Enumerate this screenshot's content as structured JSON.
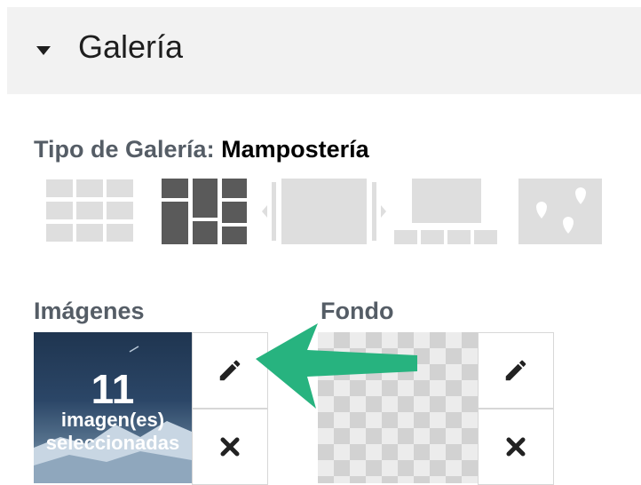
{
  "section": {
    "title": "Galería",
    "icon": "caret-down-icon"
  },
  "gallery_type": {
    "label": "Tipo de Galería:",
    "selected": "Mampostería",
    "options": [
      {
        "icon": "grid-layout-icon",
        "selected": false
      },
      {
        "icon": "masonry-layout-icon",
        "selected": true
      },
      {
        "icon": "slider-layout-icon",
        "selected": false
      },
      {
        "icon": "thumbnail-slider-layout-icon",
        "selected": false
      },
      {
        "icon": "map-layout-icon",
        "selected": false
      }
    ]
  },
  "images": {
    "label": "Imágenes",
    "count": "11",
    "caption_line1": "imagen(es)",
    "caption_line2": "seleccionadas",
    "edit_icon": "pencil-icon",
    "remove_icon": "close-icon"
  },
  "background": {
    "label": "Fondo",
    "edit_icon": "pencil-icon",
    "remove_icon": "close-icon"
  },
  "annotation": {
    "icon": "arrow-left-icon",
    "color": "#27b37f"
  },
  "colors": {
    "header_bg": "#f2f2f2",
    "selected_icon": "#5a5a5a",
    "unselected_icon": "#dedede"
  }
}
